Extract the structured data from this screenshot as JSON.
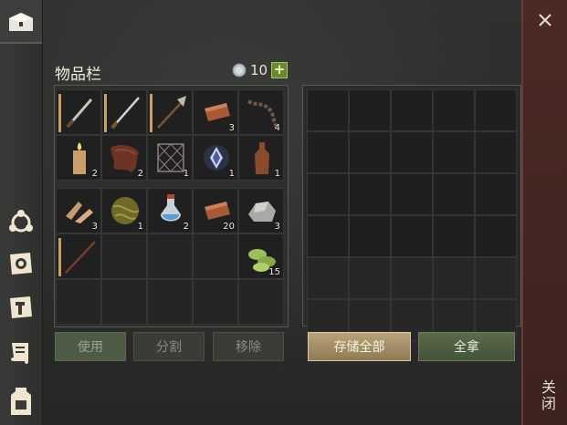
{
  "rail": {
    "tabs": [
      {
        "icon": "chest-icon"
      },
      {
        "icon": "crafting-wheel-icon"
      },
      {
        "icon": "sun-scroll-icon"
      },
      {
        "icon": "hammer-map-icon"
      },
      {
        "icon": "scroll-icon"
      },
      {
        "icon": "backpack-icon"
      }
    ]
  },
  "inventory": {
    "title": "物品栏",
    "currency_value": "10",
    "plus_label": "+",
    "items": [
      {
        "icon": "sword-icon",
        "count": ""
      },
      {
        "icon": "long-sword-icon",
        "count": ""
      },
      {
        "icon": "halberd-icon",
        "count": ""
      },
      {
        "icon": "copper-ingot-icon",
        "count": "3"
      },
      {
        "icon": "chain-icon",
        "count": "4"
      },
      {
        "icon": "candle-icon",
        "count": "2"
      },
      {
        "icon": "leather-icon",
        "count": "2"
      },
      {
        "icon": "net-icon",
        "count": "1"
      },
      {
        "icon": "crystal-icon",
        "count": "1"
      },
      {
        "icon": "bottle-icon",
        "count": "1"
      },
      {
        "icon": "wood-chips-icon",
        "count": "3"
      },
      {
        "icon": "yarn-ball-icon",
        "count": "1"
      },
      {
        "icon": "potion-icon",
        "count": "2"
      },
      {
        "icon": "copper-ingot-icon",
        "count": "20"
      },
      {
        "icon": "stone-icon",
        "count": "3"
      },
      {
        "icon": "staff-icon",
        "count": ""
      },
      {
        "icon": "herb-icon",
        "count": "15"
      }
    ],
    "buttons": {
      "use": "使用",
      "split": "分割",
      "remove": "移除"
    }
  },
  "storage": {
    "buttons": {
      "store_all": "存储全部",
      "take_all": "全拿"
    }
  },
  "close_label": "关闭",
  "colors": {
    "accent_gold": "#b8a37a",
    "close_panel": "#4b2a25"
  }
}
